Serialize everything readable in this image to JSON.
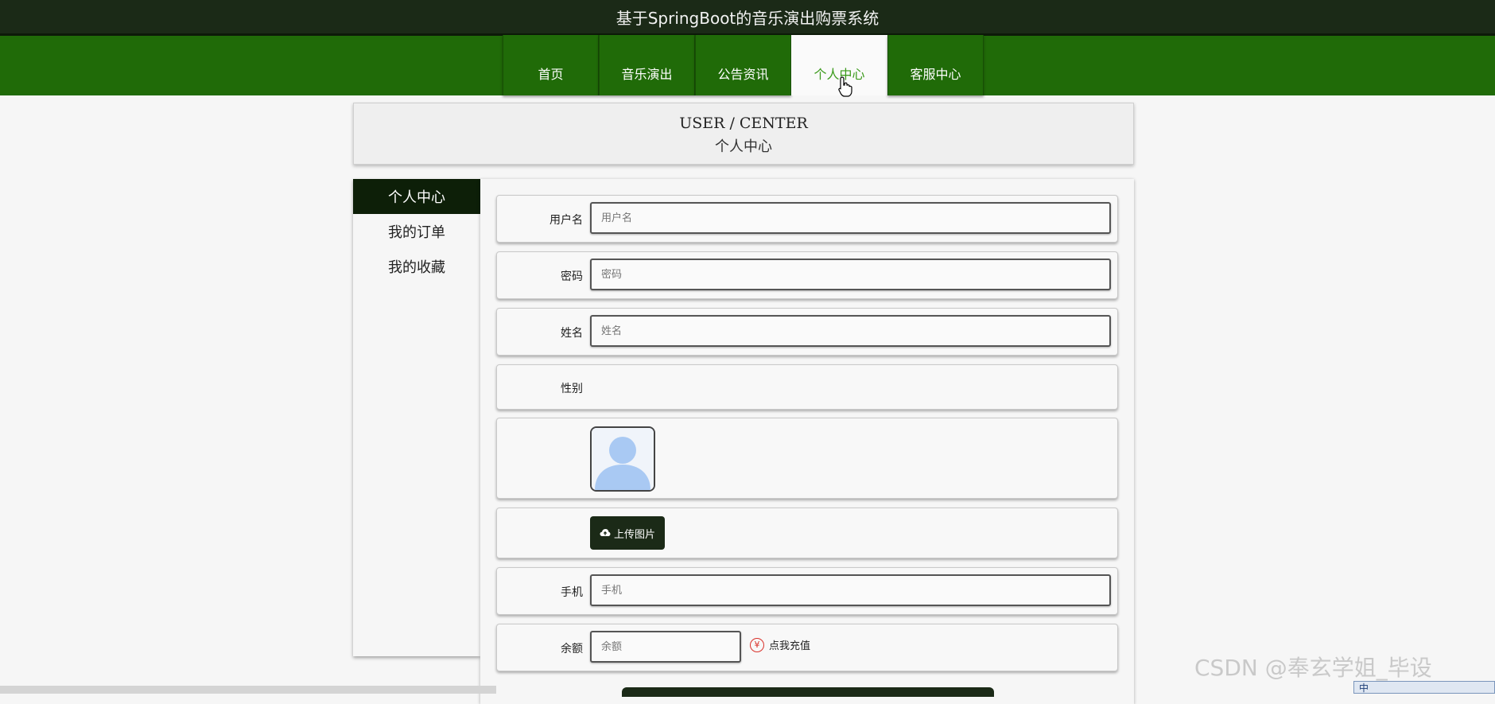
{
  "header": {
    "title": "基于SpringBoot的音乐演出购票系统"
  },
  "nav": {
    "items": [
      {
        "label": "首页"
      },
      {
        "label": "音乐演出"
      },
      {
        "label": "公告资讯"
      },
      {
        "label": "个人中心",
        "active": true
      },
      {
        "label": "客服中心"
      }
    ]
  },
  "banner": {
    "en": "USER / CENTER",
    "cn": "个人中心"
  },
  "sidebar": {
    "items": [
      {
        "label": "个人中心",
        "active": true
      },
      {
        "label": "我的订单"
      },
      {
        "label": "我的收藏"
      }
    ]
  },
  "form": {
    "username": {
      "label": "用户名",
      "placeholder": "用户名"
    },
    "password": {
      "label": "密码",
      "placeholder": "密码"
    },
    "name": {
      "label": "姓名",
      "placeholder": "姓名"
    },
    "gender": {
      "label": "性别"
    },
    "upload_label": "上传图片",
    "phone": {
      "label": "手机",
      "placeholder": "手机"
    },
    "balance": {
      "label": "余额",
      "placeholder": "余额"
    },
    "recharge_label": "点我充值",
    "recharge_symbol": "¥"
  },
  "watermark": "CSDN @奉玄学姐_毕设",
  "ime": {
    "label": "中"
  },
  "colors": {
    "header_bg": "#1b2a17",
    "nav_bg": "#206b08",
    "active_text": "#3b9a1b",
    "sidebar_active_bg": "#0d1f08"
  }
}
